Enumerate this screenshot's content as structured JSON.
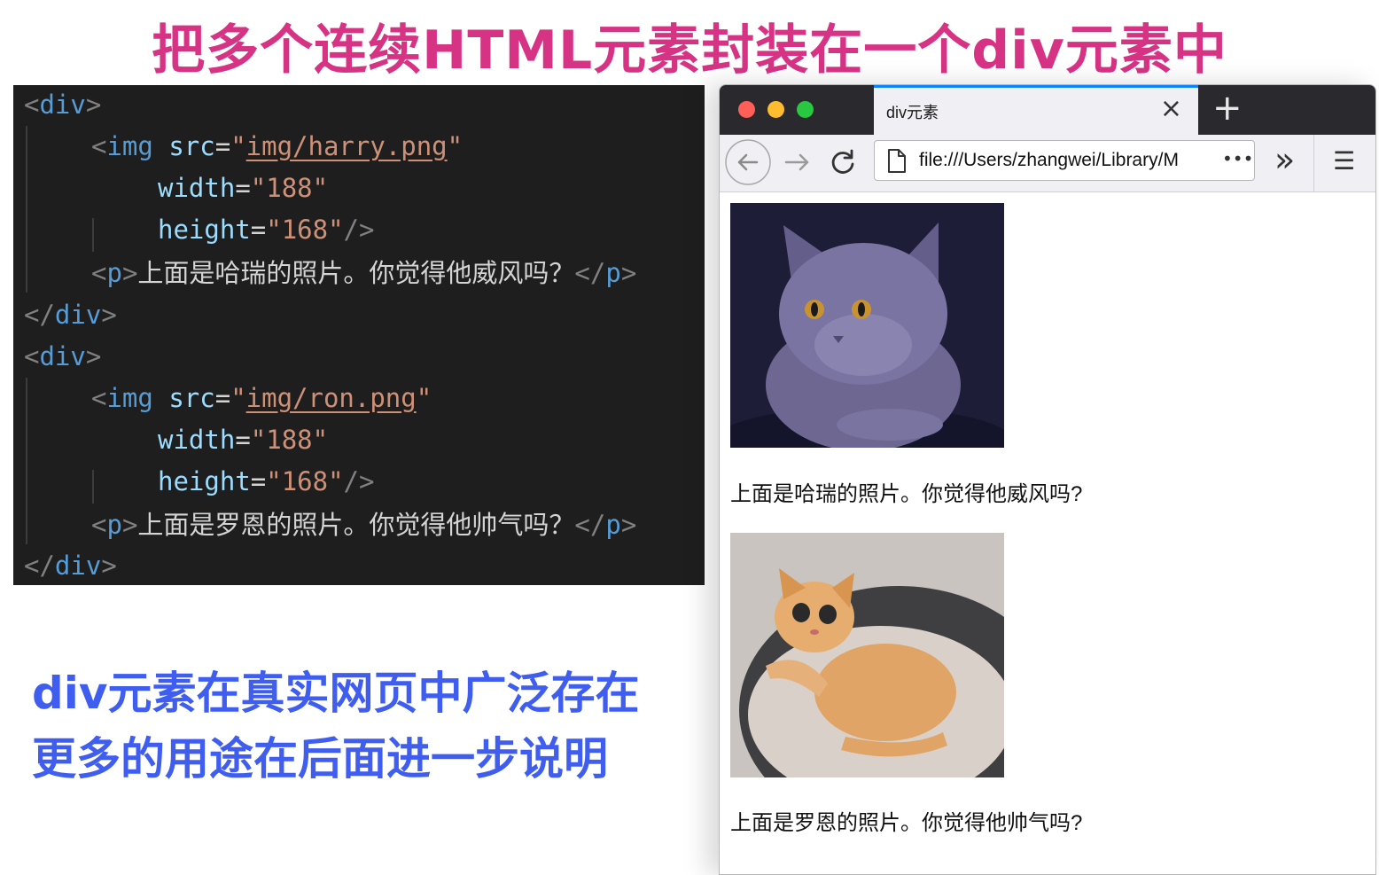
{
  "title": "把多个连续HTML元素封装在一个div元素中",
  "code": {
    "div1_open": "div",
    "img1_tag": "img",
    "src_attr": "src",
    "img1_src": "img/harry.png",
    "width_attr": "width",
    "width_val": "\"188\"",
    "height_attr": "height",
    "height_val": "\"168\"",
    "p_tag": "p",
    "p1_text": "上面是哈瑞的照片。你觉得他威风吗？",
    "div_tag": "div",
    "img2_src": "img/ron.png",
    "p2_text": "上面是罗恩的照片。你觉得他帅气吗？"
  },
  "notes": {
    "line1": "div元素在真实网页中广泛存在",
    "line2": "更多的用途在后面进一步说明"
  },
  "browser": {
    "tab_title": "div元素",
    "url": "file:///Users/zhangwei/Library/M",
    "url_more": "•••",
    "overflow_icon_label": "»",
    "menu_icon_label": "☰",
    "photo1_caption": "上面是哈瑞的照片。你觉得他威风吗?",
    "photo2_caption": "上面是罗恩的照片。你觉得他帅气吗?"
  },
  "colors": {
    "title": "#d63384",
    "note": "#3f5ef0",
    "code_bg": "#1e1e1e",
    "tab_accent": "#0a84ff"
  }
}
